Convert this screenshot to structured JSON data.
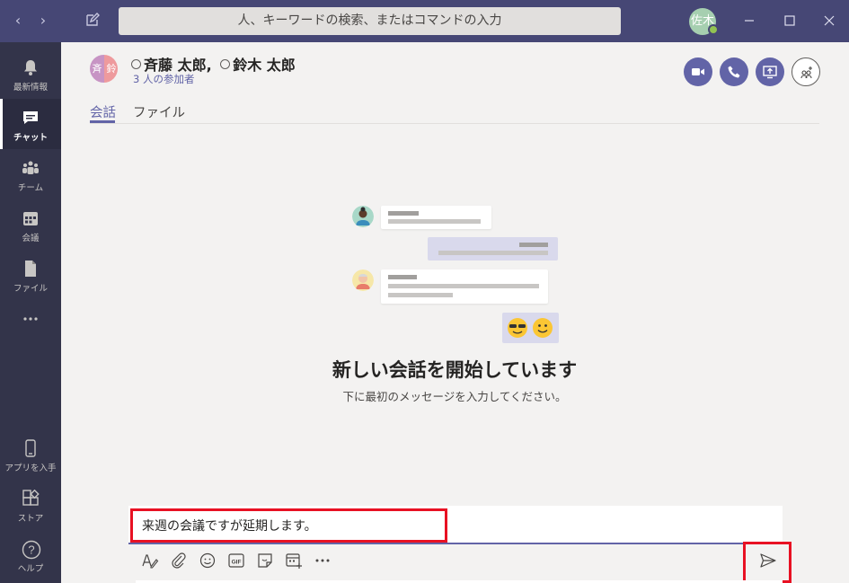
{
  "titlebar": {
    "search_placeholder": "人、キーワードの検索、またはコマンドの入力",
    "user_avatar_initials": "佐木"
  },
  "rail": [
    {
      "label": "最新情報",
      "icon": "bell-icon"
    },
    {
      "label": "チャット",
      "icon": "chat-icon",
      "active": true
    },
    {
      "label": "チーム",
      "icon": "teams-icon"
    },
    {
      "label": "会議",
      "icon": "calendar-icon"
    },
    {
      "label": "ファイル",
      "icon": "file-icon"
    },
    {
      "label": "",
      "icon": "more-icon"
    }
  ],
  "rail_bottom": [
    {
      "label": "アプリを入手",
      "icon": "phone-icon"
    },
    {
      "label": "ストア",
      "icon": "store-icon"
    },
    {
      "label": "ヘルプ",
      "icon": "help-icon"
    }
  ],
  "chat": {
    "avatar_left": "斉",
    "avatar_right": "鈴",
    "participant1": "斉藤 太郎",
    "separator": ",",
    "participant2": "鈴木 太郎",
    "participants_count": "3 人の参加者",
    "tabs": [
      "会話",
      "ファイル"
    ]
  },
  "empty_state": {
    "title": "新しい会話を開始しています",
    "subtitle": "下に最初のメッセージを入力してください。"
  },
  "compose": {
    "text": "来週の会議ですが延期します。"
  },
  "colors": {
    "brand": "#6264a7",
    "titlebar": "#464775",
    "rail": "#33344a",
    "highlight": "#e81123"
  }
}
